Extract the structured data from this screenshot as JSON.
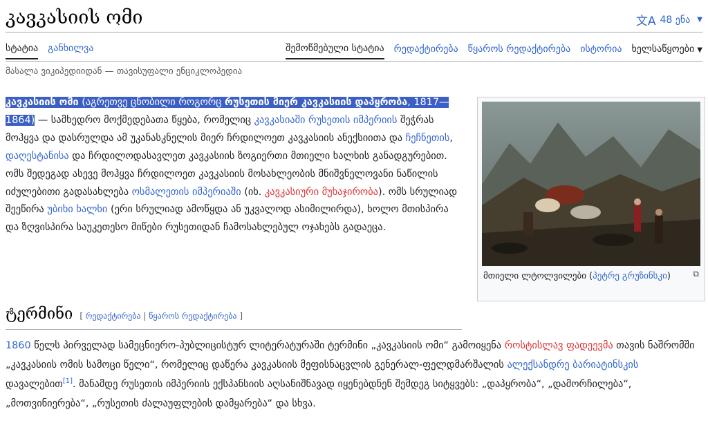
{
  "header": {
    "title": "კავკასიის ომი",
    "lang_count": "48 ენა"
  },
  "tabs": {
    "left": [
      "სტატია",
      "განხილვა"
    ],
    "right": [
      "შემოწმებული სტატია",
      "რედაქტირება",
      "წყაროს რედაქტირება",
      "ისტორია",
      "ხელსაწყოები"
    ]
  },
  "tagline": "მასალა ვიკიპედიიდან — თავისუფალი ენციკლოპედია",
  "intro": {
    "bold_title": "კავკასიის ომი",
    "t1": " (აგრეთვე ცნობილი როგორც ",
    "bold_alt": "რუსეთის მიერ კავკასიის დაპყრობა",
    "t2": ", 1817—1864)",
    "t3": " — სამხედრო მოქმედებათა წყება, რომელიც ",
    "l1": "კავკასიაში რუსეთის იმპერიის",
    "t4": " შეჭრას მოჰყვა და დასრულდა ამ უკანასკნელის მიერ ჩრდილოეთ კავკასიის ანექსიითა და ",
    "l2": "ჩეჩნეთის",
    "t5": ", ",
    "l3": "დაღესტანისა",
    "t6": " და ჩრდილოდასავლეთ კავკასიის ზოგიერთი მთიელი ხალხის განადგურებით. ომს შედეგად ასევე მოჰყვა ჩრდილოეთ კავკასიის მოსახლეობის მნიშვნელოვანი ნაწილის იძულებითი გადასახლება ",
    "l4": "ოსმალეთის იმპერიაში",
    "t7": " (იხ. ",
    "r1": "კავკასიური მუხაჯირობა",
    "t8": "). ომს სრულიად შეეწირა ",
    "l5": "უბიხი ხალხი",
    "t9": " (ერი სრულიად ამოწყდა ან უკვალოდ ასიმილირდა), ხოლო მთისპირა და ზღვისპირა საუკეთესო მიწები რუსეთიდან ჩამოსახლებულ ოჯახებს გადაეცა."
  },
  "infobox": {
    "caption_text": "მთიელი ლტოლვილები (",
    "caption_link": "პეტრე გრუზინსკი",
    "caption_end": ")",
    "enlarge_icon": "⧉"
  },
  "section": {
    "heading": "ტერმინი",
    "edit_open": "[ ",
    "edit1": "რედაქტირება",
    "edit_sep": " | ",
    "edit2": "წყაროს რედაქტირება",
    "edit_close": " ]"
  },
  "p2": {
    "l1": "1860",
    "t1": " წელს პირველად სამეცნიერო-პუბლიცისტურ ლიტერატურაში ტერმინი „კავკასიის ომი“ გამოიყენა ",
    "r1": "როსტისლავ ფადეევმა",
    "t2": " თავის ნაშრომში „კავკასიის ომის სამოცი წელი“, რომელიც დაწერა კავკასიის მეფისნაცვლის გენერალ-ფელდმარშალის ",
    "l2": "ალექსანდრე ბარიატინსკის",
    "t3": " დავალებით",
    "ref": "[1]",
    "t4": ". მანამდე რუსეთის იმპერიის ექსპანსიის აღსანიშნავად იყენებდნენ შემდეგ სიტყვებს: „დაპყრობა“, „დამორჩილება“, „მოთვინიერება“, „რუსეთის ძალაუფლების დამყარება“ და სხვა."
  }
}
